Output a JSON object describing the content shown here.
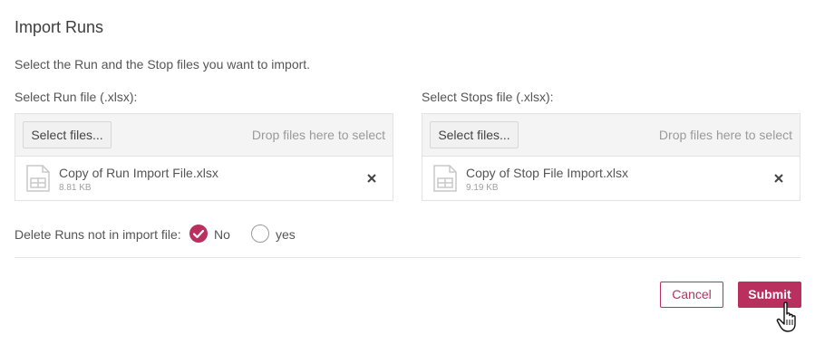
{
  "dialog": {
    "title": "Import Runs",
    "instructions": "Select the Run and the Stop files you want to import."
  },
  "run_upload": {
    "label": "Select Run file (.xlsx):",
    "select_button": "Select files...",
    "drop_hint": "Drop files here to select",
    "file": {
      "name": "Copy of Run Import File.xlsx",
      "size": "8.81 KB",
      "icon": "spreadsheet-file-icon"
    }
  },
  "stops_upload": {
    "label": "Select Stops file (.xlsx):",
    "select_button": "Select files...",
    "drop_hint": "Drop files here to select",
    "file": {
      "name": "Copy of Stop File Import.xlsx",
      "size": "9.19 KB",
      "icon": "spreadsheet-file-icon"
    }
  },
  "delete_option": {
    "label": "Delete Runs not in import file:",
    "options": [
      {
        "label": "No",
        "checked": true
      },
      {
        "label": "yes",
        "checked": false
      }
    ]
  },
  "footer": {
    "cancel_label": "Cancel",
    "submit_label": "Submit"
  },
  "colors": {
    "accent": "#b92f5e",
    "text": "#555555",
    "hint": "#9a9a9a"
  }
}
